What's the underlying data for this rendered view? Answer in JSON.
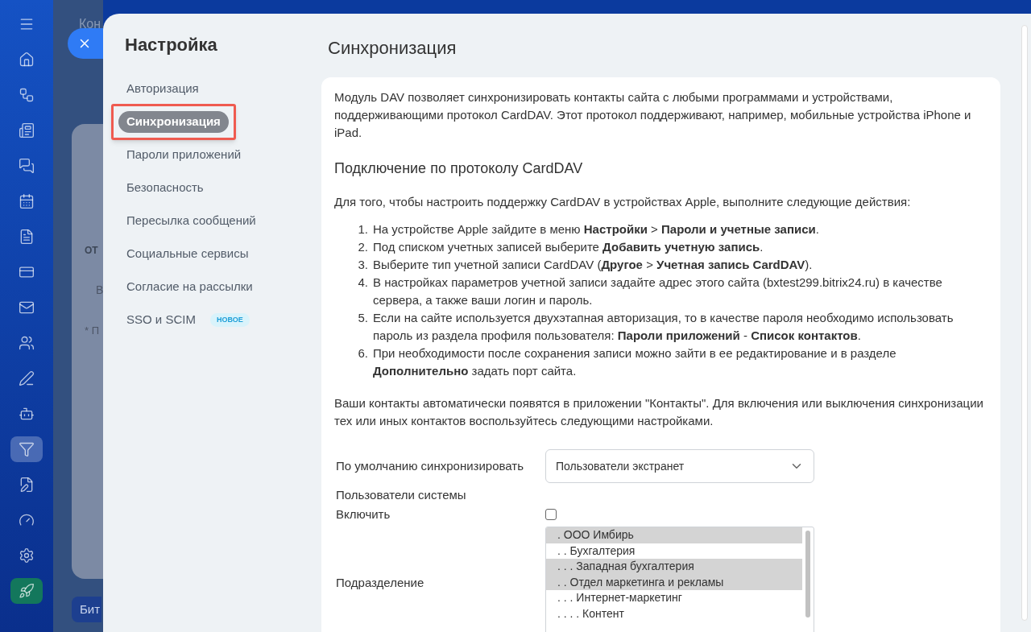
{
  "app_sidebar": {
    "items": [
      {
        "kind": "menu",
        "selected": false
      },
      {
        "kind": "home",
        "selected": false
      },
      {
        "kind": "workflow",
        "selected": false
      },
      {
        "kind": "news",
        "selected": false
      },
      {
        "kind": "chat",
        "selected": false
      },
      {
        "kind": "calendar",
        "selected": false
      },
      {
        "kind": "document",
        "selected": false
      },
      {
        "kind": "card",
        "selected": false
      },
      {
        "kind": "mail",
        "selected": false
      },
      {
        "kind": "users",
        "selected": false
      },
      {
        "kind": "sign",
        "selected": false
      },
      {
        "kind": "bot",
        "selected": false
      },
      {
        "kind": "funnel",
        "selected": true
      },
      {
        "kind": "edit",
        "selected": false
      },
      {
        "kind": "gauge",
        "selected": false
      },
      {
        "kind": "settings",
        "selected": false
      },
      {
        "kind": "rocket",
        "selected": false
      }
    ]
  },
  "background_page": {
    "title": "Кон",
    "column_header": "ОТ",
    "field": "В",
    "note": "* П",
    "footer": "Бит"
  },
  "settings_nav": {
    "title": "Настройка",
    "items": [
      {
        "label": "Авторизация",
        "selected": false,
        "highlighted": false
      },
      {
        "label": "Синхронизация",
        "selected": true,
        "highlighted": true
      },
      {
        "label": "Пароли приложений",
        "selected": false,
        "highlighted": false
      },
      {
        "label": "Безопасность",
        "selected": false,
        "highlighted": false
      },
      {
        "label": "Пересылка сообщений",
        "selected": false,
        "highlighted": false
      },
      {
        "label": "Социальные сервисы",
        "selected": false,
        "highlighted": false
      },
      {
        "label": "Согласие на рассылки",
        "selected": false,
        "highlighted": false
      },
      {
        "label": "SSO и SCIM",
        "selected": false,
        "highlighted": false,
        "badge": "НОВОЕ"
      }
    ]
  },
  "page_title": "Синхронизация",
  "intro": "Модуль DAV позволяет синхронизировать контакты сайта с любыми программами и устройствами, поддерживающими протокол CardDAV. Этот протокол поддерживают, например, мобильные устройства iPhone и iPad.",
  "subheading": "Подключение по протоколу CardDAV",
  "instructions_intro": "Для того, чтобы настроить поддержку CardDAV в устройствах Apple, выполните следующие действия:",
  "steps": [
    {
      "number": "1.",
      "text": "На устройстве Apple зайдите в меню **Настройки** > **Пароли и учетные записи**."
    },
    {
      "number": "2.",
      "text": "Под списком учетных записей выберите **Добавить учетную запись**."
    },
    {
      "number": "3.",
      "text": "Выберите тип учетной записи CardDAV (**Другое** > **Учетная запись CardDAV**)."
    },
    {
      "number": "4.",
      "text": "В настройках параметров учетной записи задайте адрес этого сайта (bxtest299.bitrix24.ru) в качестве сервера, а также ваши логин и пароль."
    },
    {
      "number": "5.",
      "text": "Если на сайте используется двухэтапная авторизация, то в качестве пароля необходимо использовать пароль из раздела профиля пользователя: **Пароли приложений** - **Список контактов**."
    },
    {
      "number": "6.",
      "text": "При необходимости после сохранения записи можно зайти в ее редактирование и в разделе **Дополнительно** задать порт сайта."
    }
  ],
  "outro": "Ваши контакты автоматически появятся в приложении \"Контакты\". Для включения или выключения синхронизации тех или иных контактов воспользуйтесь следующими настройками.",
  "form": {
    "default_sync": {
      "label": "По умолчанию синхронизировать",
      "value": "Пользователи экстранет"
    },
    "system_users": "Пользователи системы",
    "enable": {
      "label": "Включить",
      "checked": false
    },
    "department": {
      "label": "Подразделение",
      "options": [
        {
          "label": ". ООО Имбирь",
          "selected": true
        },
        {
          "label": ". . Бухгалтерия",
          "selected": false
        },
        {
          "label": ". . . Западная бухгалтерия",
          "selected": true
        },
        {
          "label": ". . Отдел маркетинга и рекламы",
          "selected": true
        },
        {
          "label": ". . . Интернет-маркетинг",
          "selected": false
        },
        {
          "label": ". . . . Контент",
          "selected": false
        }
      ]
    }
  }
}
